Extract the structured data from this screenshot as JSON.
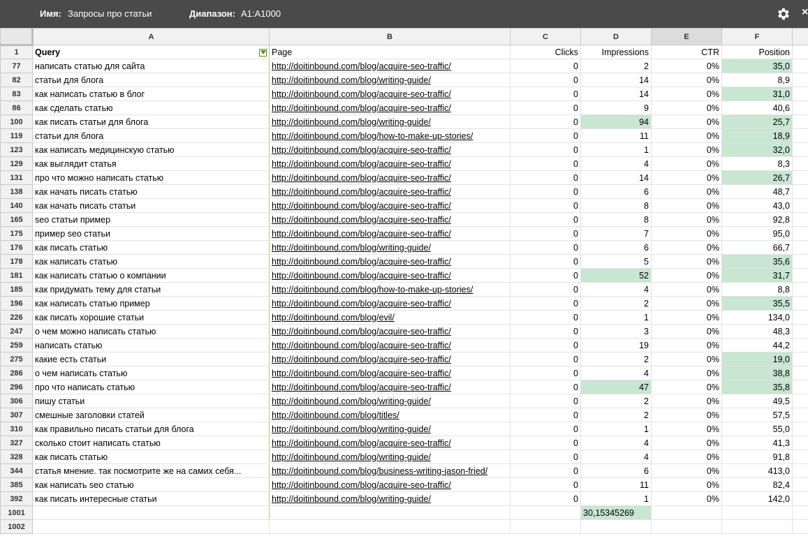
{
  "toolbar": {
    "name_label": "Имя:",
    "name_value": "Запросы про статьи",
    "range_label": "Диапазон:",
    "range_value": "A1:A1000",
    "settings_icon": "gear-icon",
    "close_icon": "close-icon",
    "close_glyph": "×"
  },
  "columns": [
    "A",
    "B",
    "C",
    "D",
    "E",
    "F"
  ],
  "header_row": {
    "rownum": "1",
    "query": "Query",
    "page": "Page",
    "clicks": "Clicks",
    "impressions": "Impressions",
    "ctr": "CTR",
    "position": "Position"
  },
  "rows": [
    {
      "n": "77",
      "query": "написать статью для сайта",
      "page": "http://doitinbound.com/blog/acquire-seo-traffic/",
      "clicks": "0",
      "impressions": "2",
      "ctr": "0%",
      "position": "35,0",
      "hl_imp": false,
      "hl_pos": true
    },
    {
      "n": "82",
      "query": "статьи для блога",
      "page": "http://doitinbound.com/blog/writing-guide/",
      "clicks": "0",
      "impressions": "14",
      "ctr": "0%",
      "position": "8,9",
      "hl_imp": false,
      "hl_pos": false
    },
    {
      "n": "83",
      "query": "как написать статью в блог",
      "page": "http://doitinbound.com/blog/acquire-seo-traffic/",
      "clicks": "0",
      "impressions": "14",
      "ctr": "0%",
      "position": "31,0",
      "hl_imp": false,
      "hl_pos": true
    },
    {
      "n": "86",
      "query": "как сделать статью",
      "page": "http://doitinbound.com/blog/acquire-seo-traffic/",
      "clicks": "0",
      "impressions": "9",
      "ctr": "0%",
      "position": "40,6",
      "hl_imp": false,
      "hl_pos": false
    },
    {
      "n": "100",
      "query": "как писать статьи для блога",
      "page": "http://doitinbound.com/blog/writing-guide/",
      "clicks": "0",
      "impressions": "94",
      "ctr": "0%",
      "position": "25,7",
      "hl_imp": true,
      "hl_pos": true
    },
    {
      "n": "119",
      "query": "статьи для блога",
      "page": "http://doitinbound.com/blog/how-to-make-up-stories/",
      "clicks": "0",
      "impressions": "11",
      "ctr": "0%",
      "position": "18,9",
      "hl_imp": false,
      "hl_pos": true
    },
    {
      "n": "123",
      "query": "как написать медицинскую статью",
      "page": "http://doitinbound.com/blog/acquire-seo-traffic/",
      "clicks": "0",
      "impressions": "1",
      "ctr": "0%",
      "position": "32,0",
      "hl_imp": false,
      "hl_pos": true
    },
    {
      "n": "129",
      "query": "как выглядит статья",
      "page": "http://doitinbound.com/blog/acquire-seo-traffic/",
      "clicks": "0",
      "impressions": "4",
      "ctr": "0%",
      "position": "8,3",
      "hl_imp": false,
      "hl_pos": false
    },
    {
      "n": "131",
      "query": "про что можно написать статью",
      "page": "http://doitinbound.com/blog/acquire-seo-traffic/",
      "clicks": "0",
      "impressions": "14",
      "ctr": "0%",
      "position": "26,7",
      "hl_imp": false,
      "hl_pos": true
    },
    {
      "n": "138",
      "query": "как начать писать статью",
      "page": "http://doitinbound.com/blog/acquire-seo-traffic/",
      "clicks": "0",
      "impressions": "6",
      "ctr": "0%",
      "position": "48,7",
      "hl_imp": false,
      "hl_pos": false
    },
    {
      "n": "140",
      "query": "как начать писать статьи",
      "page": "http://doitinbound.com/blog/acquire-seo-traffic/",
      "clicks": "0",
      "impressions": "8",
      "ctr": "0%",
      "position": "43,0",
      "hl_imp": false,
      "hl_pos": false
    },
    {
      "n": "165",
      "query": "seo статьи пример",
      "page": "http://doitinbound.com/blog/acquire-seo-traffic/",
      "clicks": "0",
      "impressions": "8",
      "ctr": "0%",
      "position": "92,8",
      "hl_imp": false,
      "hl_pos": false
    },
    {
      "n": "175",
      "query": "пример seo статьи",
      "page": "http://doitinbound.com/blog/acquire-seo-traffic/",
      "clicks": "0",
      "impressions": "7",
      "ctr": "0%",
      "position": "95,0",
      "hl_imp": false,
      "hl_pos": false
    },
    {
      "n": "176",
      "query": "как писать статью",
      "page": "http://doitinbound.com/blog/writing-guide/",
      "clicks": "0",
      "impressions": "6",
      "ctr": "0%",
      "position": "66,7",
      "hl_imp": false,
      "hl_pos": false
    },
    {
      "n": "178",
      "query": "как написать статью",
      "page": "http://doitinbound.com/blog/acquire-seo-traffic/",
      "clicks": "0",
      "impressions": "5",
      "ctr": "0%",
      "position": "35,6",
      "hl_imp": false,
      "hl_pos": true
    },
    {
      "n": "181",
      "query": "как написать статью о компании",
      "page": "http://doitinbound.com/blog/acquire-seo-traffic/",
      "clicks": "0",
      "impressions": "52",
      "ctr": "0%",
      "position": "31,7",
      "hl_imp": true,
      "hl_pos": true
    },
    {
      "n": "185",
      "query": "как придумать тему для статьи",
      "page": "http://doitinbound.com/blog/how-to-make-up-stories/",
      "clicks": "0",
      "impressions": "4",
      "ctr": "0%",
      "position": "8,8",
      "hl_imp": false,
      "hl_pos": false
    },
    {
      "n": "196",
      "query": "как написать статью пример",
      "page": "http://doitinbound.com/blog/acquire-seo-traffic/",
      "clicks": "0",
      "impressions": "2",
      "ctr": "0%",
      "position": "35,5",
      "hl_imp": false,
      "hl_pos": true
    },
    {
      "n": "226",
      "query": "как писать хорошие статьи",
      "page": "http://doitinbound.com/blog/evil/",
      "clicks": "0",
      "impressions": "1",
      "ctr": "0%",
      "position": "134,0",
      "hl_imp": false,
      "hl_pos": false
    },
    {
      "n": "247",
      "query": "о чем можно написать статью",
      "page": "http://doitinbound.com/blog/acquire-seo-traffic/",
      "clicks": "0",
      "impressions": "3",
      "ctr": "0%",
      "position": "48,3",
      "hl_imp": false,
      "hl_pos": false
    },
    {
      "n": "259",
      "query": "написать статью",
      "page": "http://doitinbound.com/blog/acquire-seo-traffic/",
      "clicks": "0",
      "impressions": "19",
      "ctr": "0%",
      "position": "44,2",
      "hl_imp": false,
      "hl_pos": false
    },
    {
      "n": "275",
      "query": "какие есть статьи",
      "page": "http://doitinbound.com/blog/acquire-seo-traffic/",
      "clicks": "0",
      "impressions": "2",
      "ctr": "0%",
      "position": "19,0",
      "hl_imp": false,
      "hl_pos": true
    },
    {
      "n": "286",
      "query": "о чем написать статью",
      "page": "http://doitinbound.com/blog/acquire-seo-traffic/",
      "clicks": "0",
      "impressions": "4",
      "ctr": "0%",
      "position": "38,8",
      "hl_imp": false,
      "hl_pos": true
    },
    {
      "n": "296",
      "query": "про что написать статью",
      "page": "http://doitinbound.com/blog/acquire-seo-traffic/",
      "clicks": "0",
      "impressions": "47",
      "ctr": "0%",
      "position": "35,8",
      "hl_imp": true,
      "hl_pos": true
    },
    {
      "n": "306",
      "query": "пишу статьи",
      "page": "http://doitinbound.com/blog/writing-guide/",
      "clicks": "0",
      "impressions": "2",
      "ctr": "0%",
      "position": "49,5",
      "hl_imp": false,
      "hl_pos": false
    },
    {
      "n": "307",
      "query": "смешные заголовки статей",
      "page": "http://doitinbound.com/blog/titles/",
      "clicks": "0",
      "impressions": "2",
      "ctr": "0%",
      "position": "57,5",
      "hl_imp": false,
      "hl_pos": false
    },
    {
      "n": "310",
      "query": "как правильно писать статьи для блога",
      "page": "http://doitinbound.com/blog/writing-guide/",
      "clicks": "0",
      "impressions": "1",
      "ctr": "0%",
      "position": "55,0",
      "hl_imp": false,
      "hl_pos": false
    },
    {
      "n": "327",
      "query": "сколько стоит написать статью",
      "page": "http://doitinbound.com/blog/acquire-seo-traffic/",
      "clicks": "0",
      "impressions": "4",
      "ctr": "0%",
      "position": "41,3",
      "hl_imp": false,
      "hl_pos": false
    },
    {
      "n": "328",
      "query": "как писать статью",
      "page": "http://doitinbound.com/blog/writing-guide/",
      "clicks": "0",
      "impressions": "4",
      "ctr": "0%",
      "position": "91,8",
      "hl_imp": false,
      "hl_pos": false
    },
    {
      "n": "344",
      "query": "статья мнение. так посмотрите же на самих себя...",
      "page": "http://doitinbound.com/blog/business-writing-jason-fried/",
      "clicks": "0",
      "impressions": "6",
      "ctr": "0%",
      "position": "413,0",
      "hl_imp": false,
      "hl_pos": false
    },
    {
      "n": "385",
      "query": "как написать seo статью",
      "page": "http://doitinbound.com/blog/acquire-seo-traffic/",
      "clicks": "0",
      "impressions": "11",
      "ctr": "0%",
      "position": "82,4",
      "hl_imp": false,
      "hl_pos": false
    },
    {
      "n": "392",
      "query": "как писать интересные статьи",
      "page": "http://doitinbound.com/blog/writing-guide/",
      "clicks": "0",
      "impressions": "1",
      "ctr": "0%",
      "position": "142,0",
      "hl_imp": false,
      "hl_pos": false
    }
  ],
  "totals_row": {
    "n": "1001",
    "impressions_sum": "30,15345269"
  },
  "empty_row": {
    "n": "1002"
  },
  "colors": {
    "highlight": "#c8e6d1",
    "link": "#1155cc",
    "toolbar_bg": "#4a4a4a"
  }
}
